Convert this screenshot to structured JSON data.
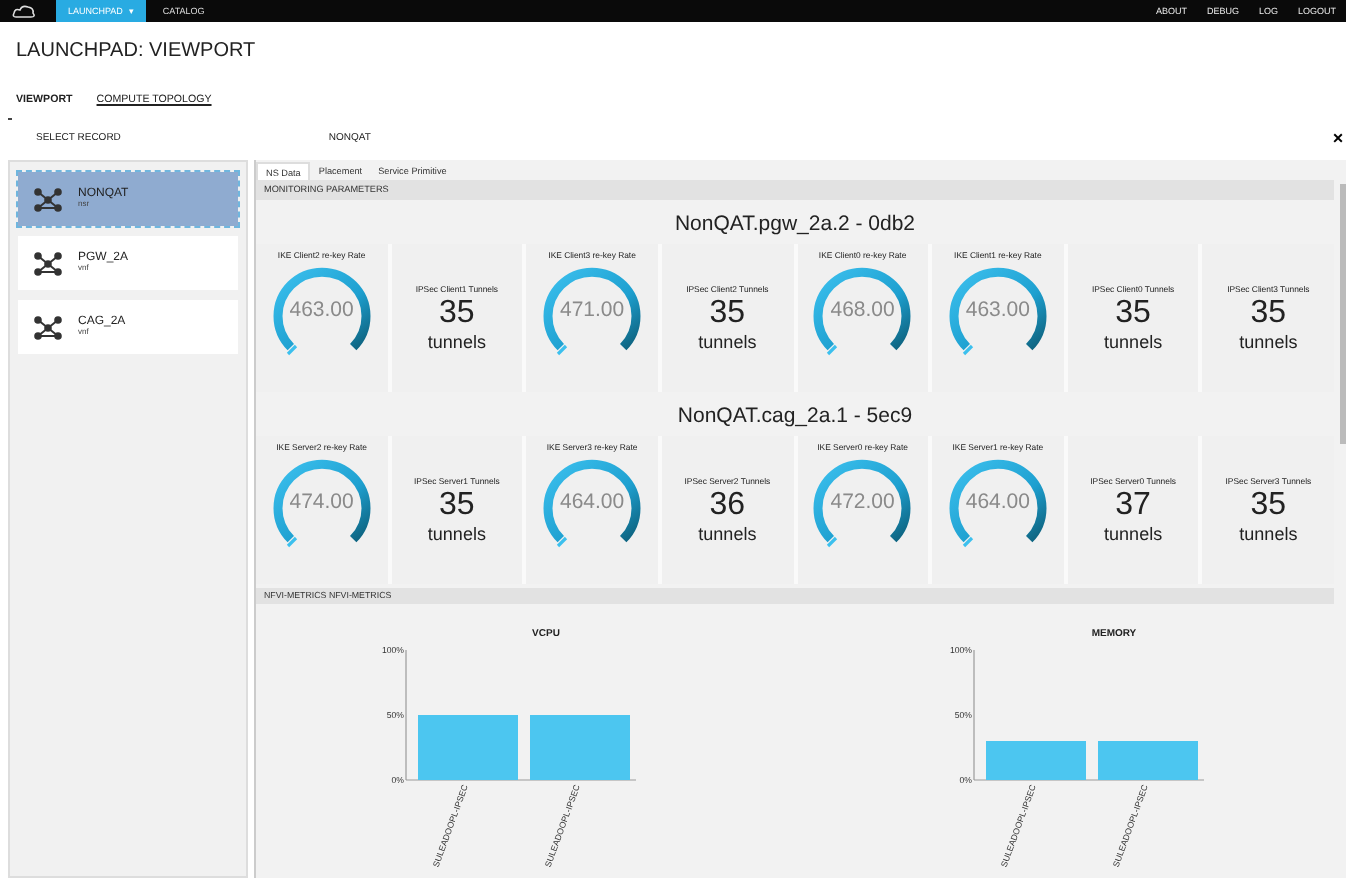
{
  "top_bar": {
    "menu": [
      {
        "label": "LAUNCHPAD",
        "selected": true,
        "caret": "▾"
      },
      {
        "label": "CATALOG",
        "selected": false
      }
    ],
    "links": [
      "ABOUT",
      "DEBUG",
      "LOG",
      "LOGOUT"
    ]
  },
  "title": "LAUNCHPAD: VIEWPORT",
  "nav_tabs": [
    {
      "label": "VIEWPORT",
      "selected": true
    },
    {
      "label": "COMPUTE TOPOLOGY",
      "selected": false
    }
  ],
  "header": {
    "select_label": "SELECT RECORD",
    "record_name": "NONQAT",
    "close": "×"
  },
  "records": [
    {
      "name": "NONQAT",
      "type": "nsr",
      "selected": true
    },
    {
      "name": "PGW_2A",
      "type": "vnf",
      "selected": false
    },
    {
      "name": "CAG_2A",
      "type": "vnf",
      "selected": false
    }
  ],
  "tabs": [
    {
      "label": "NS Data",
      "selected": true
    },
    {
      "label": "Placement",
      "selected": false
    },
    {
      "label": "Service Primitive",
      "selected": false
    }
  ],
  "monitoring": {
    "title": "MONITORING PARAMETERS",
    "groups": [
      {
        "name": "NonQAT.pgw_2a.2 - 0db2",
        "tiles": [
          {
            "kind": "gauge",
            "label": "IKE Client2 re-key Rate",
            "value": "463.00"
          },
          {
            "kind": "counter",
            "label": "IPSec Client1 Tunnels",
            "value": "35",
            "unit": "tunnels"
          },
          {
            "kind": "gauge",
            "label": "IKE Client3 re-key Rate",
            "value": "471.00"
          },
          {
            "kind": "counter",
            "label": "IPSec Client2 Tunnels",
            "value": "35",
            "unit": "tunnels"
          },
          {
            "kind": "gauge",
            "label": "IKE Client0 re-key Rate",
            "value": "468.00"
          },
          {
            "kind": "gauge",
            "label": "IKE Client1 re-key Rate",
            "value": "463.00"
          },
          {
            "kind": "counter",
            "label": "IPSec Client0 Tunnels",
            "value": "35",
            "unit": "tunnels"
          },
          {
            "kind": "counter",
            "label": "IPSec Client3 Tunnels",
            "value": "35",
            "unit": "tunnels"
          }
        ]
      },
      {
        "name": "NonQAT.cag_2a.1 - 5ec9",
        "tiles": [
          {
            "kind": "gauge",
            "label": "IKE Server2 re-key Rate",
            "value": "474.00"
          },
          {
            "kind": "counter",
            "label": "IPSec Server1 Tunnels",
            "value": "35",
            "unit": "tunnels"
          },
          {
            "kind": "gauge",
            "label": "IKE Server3 re-key Rate",
            "value": "464.00"
          },
          {
            "kind": "counter",
            "label": "IPSec Server2 Tunnels",
            "value": "36",
            "unit": "tunnels"
          },
          {
            "kind": "gauge",
            "label": "IKE Server0 re-key Rate",
            "value": "472.00"
          },
          {
            "kind": "gauge",
            "label": "IKE Server1 re-key Rate",
            "value": "464.00"
          },
          {
            "kind": "counter",
            "label": "IPSec Server0 Tunnels",
            "value": "37",
            "unit": "tunnels"
          },
          {
            "kind": "counter",
            "label": "IPSec Server3 Tunnels",
            "value": "35",
            "unit": "tunnels"
          }
        ]
      }
    ]
  },
  "nfvi": {
    "title": "NFVI-METRICS NFVI-METRICS",
    "charts": [
      {
        "chart_data": {
          "type": "bar",
          "title": "VCPU",
          "categories": [
            "SULEADOOPL-IPSEC",
            "SULEADOOPL-IPSEC"
          ],
          "values": [
            50,
            50
          ],
          "ylim": [
            0,
            100
          ],
          "yticks": [
            {
              "value": 0,
              "label": "0%"
            },
            {
              "value": 50,
              "label": "50%"
            },
            {
              "value": 100,
              "label": "100%"
            }
          ]
        }
      },
      {
        "chart_data": {
          "type": "bar",
          "title": "MEMORY",
          "categories": [
            "SULEADOOPL-IPSEC",
            "SULEADOOPL-IPSEC"
          ],
          "values": [
            30,
            30
          ],
          "ylim": [
            0,
            100
          ],
          "yticks": [
            {
              "value": 0,
              "label": "0%"
            },
            {
              "value": 50,
              "label": "50%"
            },
            {
              "value": 100,
              "label": "100%"
            }
          ]
        }
      }
    ]
  }
}
